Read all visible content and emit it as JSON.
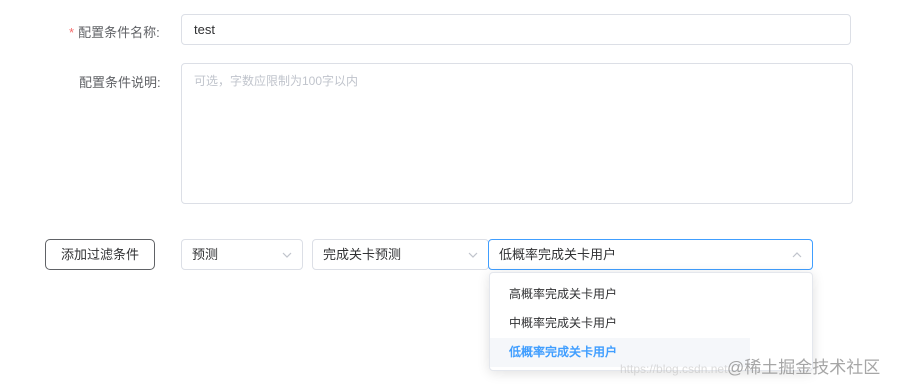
{
  "form": {
    "name_label": "配置条件名称:",
    "name_required_mark": "*",
    "name_value": "test",
    "desc_label": "配置条件说明:",
    "desc_placeholder": "可选，字数应限制为100字以内"
  },
  "filters": {
    "add_button_label": "添加过滤条件",
    "select1_value": "预测",
    "select2_value": "完成关卡预测",
    "select3_value": "低概率完成关卡用户",
    "dropdown_options": [
      "高概率完成关卡用户",
      "中概率完成关卡用户",
      "低概率完成关卡用户"
    ],
    "selected_option": "低概率完成关卡用户"
  },
  "watermark": {
    "url_text": "https://blog.csdn.net",
    "brand_text": "@稀土掘金技术社区"
  },
  "colors": {
    "primary": "#409eff",
    "required": "#f56c6c",
    "border": "#dcdfe6"
  },
  "icons": {
    "select_arrow": "chevron-down-icon",
    "select_arrow_open": "chevron-up-icon"
  }
}
